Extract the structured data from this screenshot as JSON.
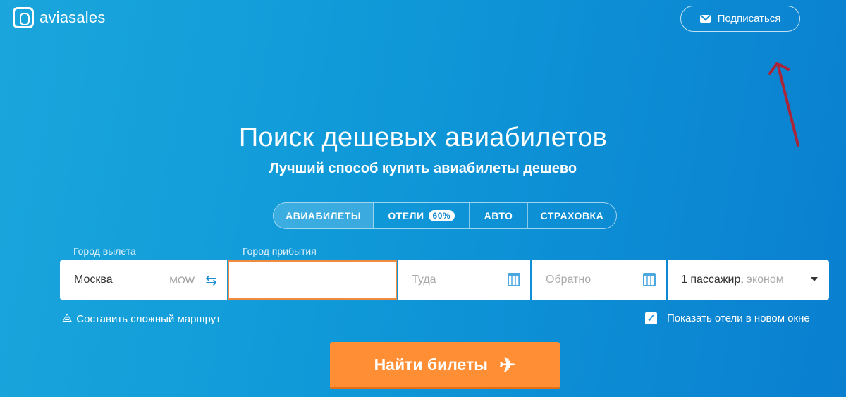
{
  "header": {
    "logo_text": "aviasales",
    "subscribe_label": "Подписаться"
  },
  "hero": {
    "title": "Поиск дешевых авиабилетов",
    "subtitle": "Лучший способ купить авиабилеты дешево"
  },
  "tabs": [
    {
      "label": "АВИАБИЛЕТЫ",
      "active": true
    },
    {
      "label": "ОТЕЛИ",
      "badge": "60%"
    },
    {
      "label": "АВТО"
    },
    {
      "label": "СТРАХОВКА"
    }
  ],
  "form": {
    "origin_label": "Город вылета",
    "origin_value": "Москва",
    "origin_code": "MOW",
    "destination_label": "Город прибытия",
    "destination_value": "",
    "depart_placeholder": "Туда",
    "return_placeholder": "Обратно",
    "passengers_value": "1 пассажир,",
    "class_value": "эконом"
  },
  "options": {
    "complex_route_label": "Составить сложный маршрут",
    "show_hotels_label": "Показать отели в новом окне",
    "show_hotels_checked": true
  },
  "search_button_label": "Найти билеты",
  "colors": {
    "accent_orange": "#ff8e35",
    "background_blue": "#0f98d8",
    "focus_border": "#f08a3c",
    "annotation_arrow": "#a8253a"
  }
}
